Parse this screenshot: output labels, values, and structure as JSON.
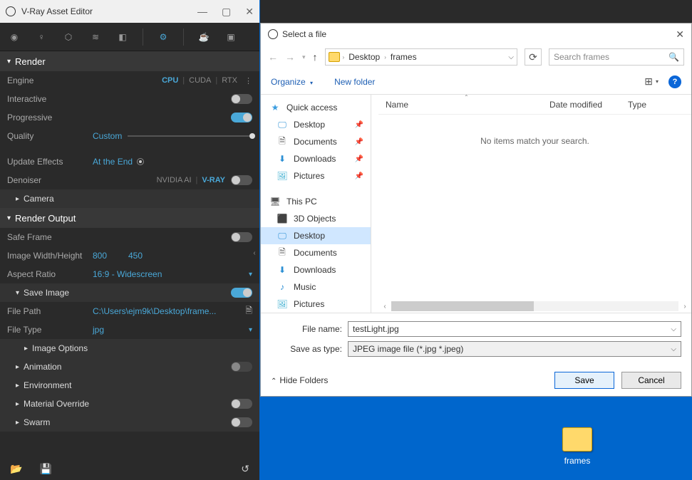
{
  "vray": {
    "title": "V-Ray Asset Editor",
    "sections": {
      "render": "Render",
      "camera": "Camera",
      "renderOutput": "Render Output",
      "saveImage": "Save Image",
      "imageOptions": "Image Options",
      "animation": "Animation",
      "environment": "Environment",
      "materialOverride": "Material Override",
      "swarm": "Swarm"
    },
    "engine": {
      "label": "Engine",
      "opt1": "CPU",
      "opt2": "CUDA",
      "opt3": "RTX"
    },
    "interactive": "Interactive",
    "progressive": "Progressive",
    "quality": {
      "label": "Quality",
      "value": "Custom"
    },
    "updateEffects": {
      "label": "Update Effects",
      "value": "At the End"
    },
    "denoiser": {
      "label": "Denoiser",
      "opt1": "NVIDIA AI",
      "opt2": "V-RAY"
    },
    "safeFrame": "Safe Frame",
    "imageWH": {
      "label": "Image Width/Height",
      "w": "800",
      "h": "450"
    },
    "aspect": {
      "label": "Aspect Ratio",
      "value": "16:9 - Widescreen"
    },
    "filePath": {
      "label": "File Path",
      "value": "C:\\Users\\ejm9k\\Desktop\\frame..."
    },
    "fileType": {
      "label": "File Type",
      "value": "jpg"
    }
  },
  "dialog": {
    "title": "Select a file",
    "breadcrumb": {
      "p1": "Desktop",
      "p2": "frames"
    },
    "searchPlaceholder": "Search frames",
    "organize": "Organize",
    "newFolder": "New folder",
    "side": {
      "quickAccess": "Quick access",
      "desktop": "Desktop",
      "documents": "Documents",
      "downloads": "Downloads",
      "pictures": "Pictures",
      "thisPC": "This PC",
      "threed": "3D Objects",
      "desktop2": "Desktop",
      "documents2": "Documents",
      "downloads2": "Downloads",
      "music": "Music",
      "pictures2": "Pictures"
    },
    "cols": {
      "name": "Name",
      "date": "Date modified",
      "type": "Type"
    },
    "empty": "No items match your search.",
    "fileName": {
      "label": "File name:",
      "value": "testLight.jpg"
    },
    "saveType": {
      "label": "Save as type:",
      "value": "JPEG image file (*.jpg *.jpeg)"
    },
    "hideFolders": "Hide Folders",
    "save": "Save",
    "cancel": "Cancel"
  },
  "desktop": {
    "folderName": "frames"
  }
}
